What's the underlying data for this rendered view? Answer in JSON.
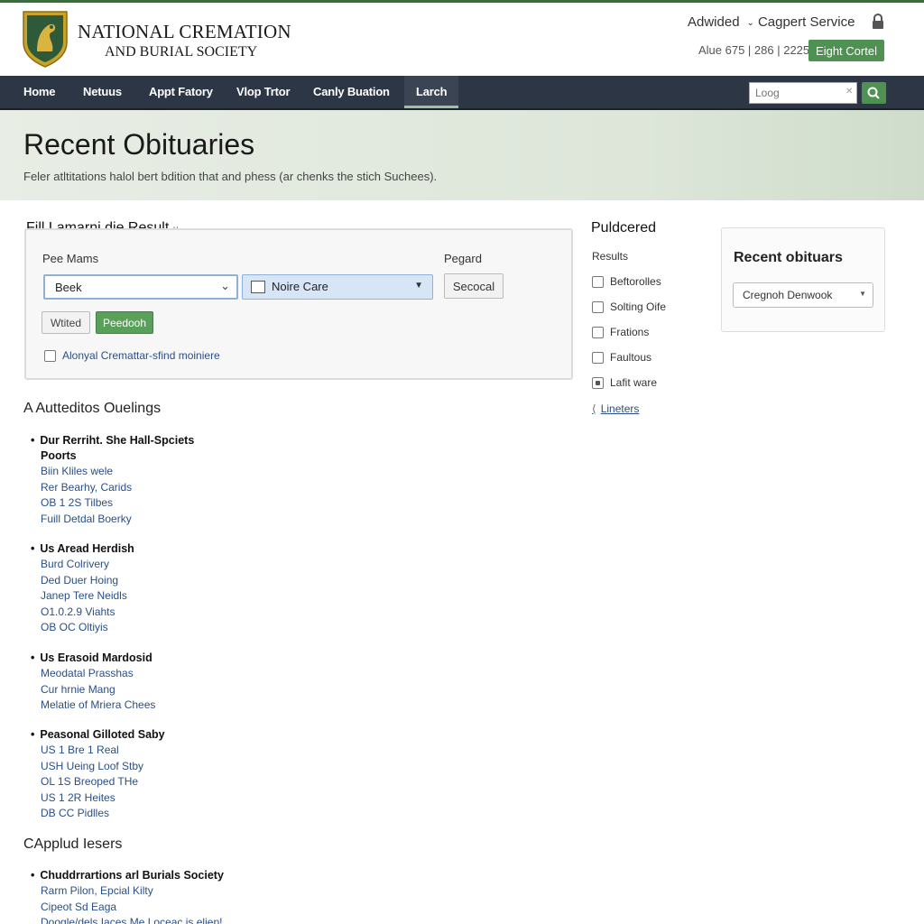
{
  "header": {
    "brand_line1": "NATIONAL CREMATION",
    "brand_line2": "AND BURIAL SOCIETY",
    "link_advised": "Adwided",
    "link_service": "Cagpert Service",
    "phone": "Alue 675 | 286 | 2225",
    "light_button": "Eight Cortel",
    "colors": {
      "accent_green": "#4f9152",
      "nav_bg": "#2d3644"
    }
  },
  "nav": {
    "items": [
      "Home",
      "Netuus",
      "Appt Fatory",
      "Vlop Trtor",
      "Canly Buation",
      "Larch"
    ],
    "search_placeholder": "Loog"
  },
  "hero": {
    "title": "Recent Obituaries",
    "subtitle": "Feler atltitations halol bert bdition that and phess (ar chenks the stich Suchees)."
  },
  "search": {
    "panel_title": "Fill Lamarni die Result",
    "name_label": "Pee Mams",
    "region_label": "Pegard",
    "select1_value": "Beek",
    "select2_value": "Noire Care",
    "second_button": "Secocal",
    "wtd_button": "Wtited",
    "go_button": "Peedooh",
    "checkbox_label": "Alonyal Cremattar-sfind moiniere"
  },
  "filters": {
    "title": "Puldcered",
    "subtitle": "Results",
    "items": [
      {
        "label": "Beftorolles",
        "checked": false
      },
      {
        "label": "Solting Oife",
        "checked": false
      },
      {
        "label": "Frations",
        "checked": false
      },
      {
        "label": "Faultous",
        "checked": false
      },
      {
        "label": "Lafit ware",
        "checked": true
      }
    ],
    "link": "Lineters"
  },
  "recent_box": {
    "title": "Recent obituars",
    "select_value": "Cregnoh Denwook"
  },
  "listing": {
    "section1": "A Autteditos Ouelings",
    "section2": "CApplud Iesers",
    "groups": [
      {
        "title": "Dur Rerriht. She Hall-Spciets",
        "subtitle": "Poorts",
        "links": [
          "Biin Kliles wele",
          "Rer Bearhy, Carids",
          "OB 1 2S Tilbes",
          "Fuill Detdal Boerky"
        ]
      },
      {
        "title": "Us Aread Herdish",
        "subtitle": "",
        "links": [
          "Burd Colrivery",
          "Ded Duer Hoing",
          "Janep Tere Neidls",
          "O1.0.2.9  Viahts",
          "OB OC Oltiyis"
        ]
      },
      {
        "title": "Us Erasoid Mardosid",
        "subtitle": "",
        "links": [
          "Meodatal Prasshas",
          "Cur hrnie Mang",
          "Melatie of Mriera Chees"
        ]
      },
      {
        "title": "Peasonal Gilloted Saby",
        "subtitle": "",
        "links": [
          "US 1  Bre 1 Real",
          "USH Ueing Loof Stby",
          "OL 1S  Breoped THe",
          "US 1 2R  Heites",
          "DB CC Pidlles"
        ]
      },
      {
        "title": "Chuddrrartions arl Burials Society",
        "subtitle": "",
        "links": [
          "Rarm Pilon, Epcial Kilty",
          "Cipeot Sd Eaga",
          "Doogle/dels Iaces Me Loceac is eliep!"
        ]
      }
    ]
  }
}
